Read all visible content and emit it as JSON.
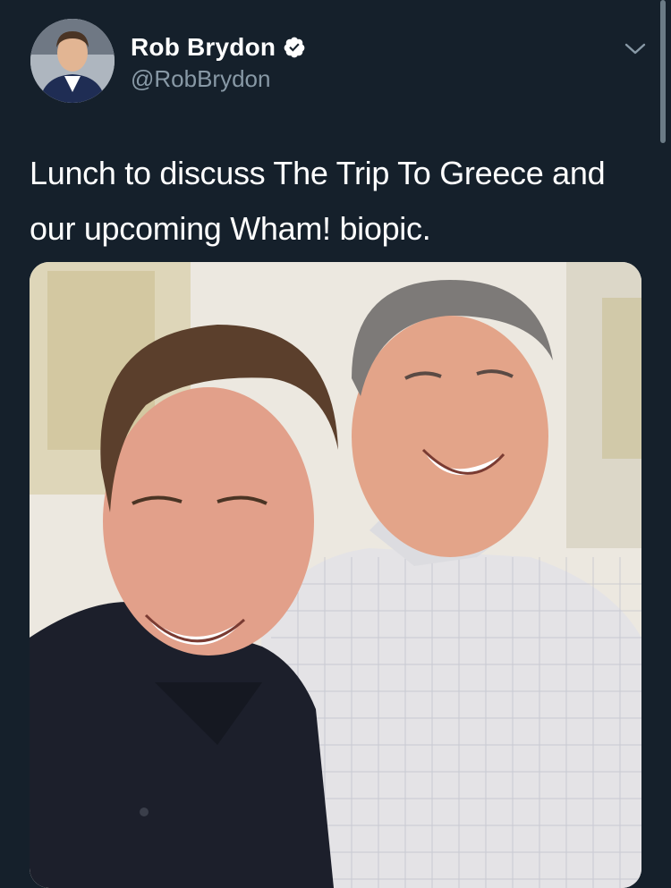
{
  "tweet": {
    "author": {
      "display_name": "Rob Brydon",
      "handle": "@RobBrydon",
      "verified": true,
      "avatar_icon": "profile-photo"
    },
    "text": "Lunch to discuss The Trip To Greece and our upcoming Wham! biopic.",
    "media": {
      "type": "photo",
      "icon": "photo-two-men-smiling"
    },
    "menu_icon": "chevron-down-icon"
  },
  "colors": {
    "background": "#15202b",
    "primary_text": "#ffffff",
    "secondary_text": "#8899a6"
  }
}
